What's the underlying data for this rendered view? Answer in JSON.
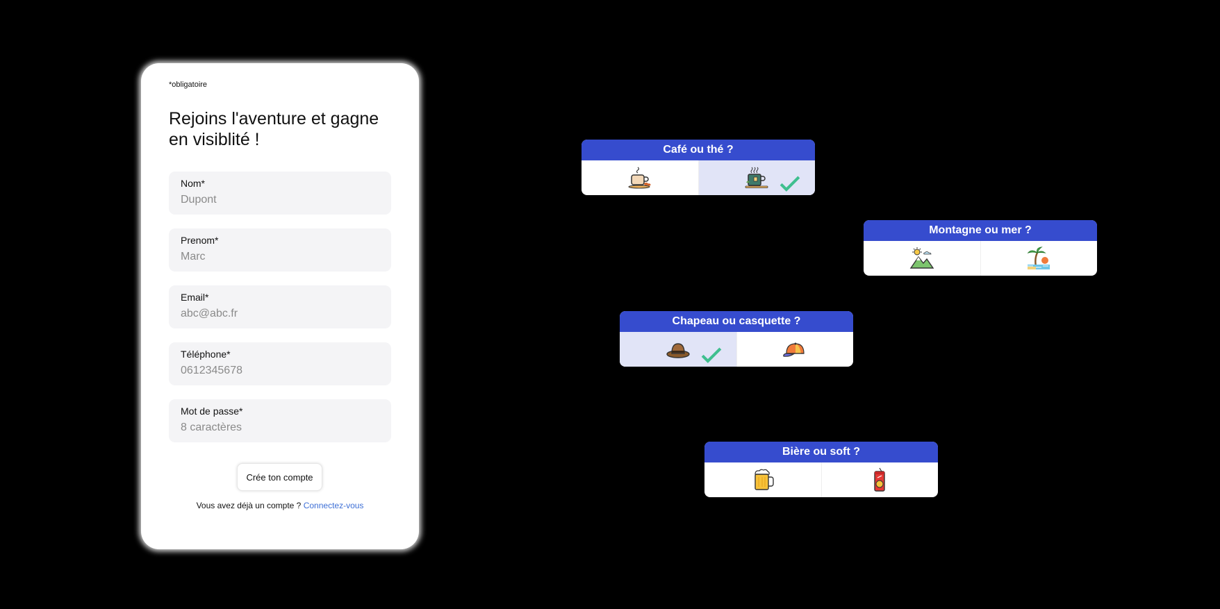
{
  "form": {
    "required_note": "*obligatoire",
    "title": "Rejoins l'aventure et gagne en visiblité !",
    "fields": [
      {
        "label": "Nom*",
        "placeholder": "Dupont"
      },
      {
        "label": "Prenom*",
        "placeholder": "Marc"
      },
      {
        "label": "Email*",
        "placeholder": "abc@abc.fr"
      },
      {
        "label": "Téléphone*",
        "placeholder": "0612345678"
      },
      {
        "label": "Mot de passe*",
        "placeholder": "8 caractères"
      }
    ],
    "submit_label": "Crée ton compte",
    "login_prompt": "Vous avez déjà un compte ?",
    "login_link": "Connectez-vous"
  },
  "choices": [
    {
      "question": "Café ou thé ?",
      "options": [
        {
          "icon": "coffee-cup-icon",
          "selected": false
        },
        {
          "icon": "tea-pot-icon",
          "selected": true
        }
      ]
    },
    {
      "question": "Montagne ou mer ?",
      "options": [
        {
          "icon": "mountain-icon",
          "selected": false
        },
        {
          "icon": "beach-palm-icon",
          "selected": false
        }
      ]
    },
    {
      "question": "Chapeau ou casquette ?",
      "options": [
        {
          "icon": "hat-icon",
          "selected": true
        },
        {
          "icon": "cap-icon",
          "selected": false
        }
      ]
    },
    {
      "question": "Bière ou soft ?",
      "options": [
        {
          "icon": "beer-mug-icon",
          "selected": false
        },
        {
          "icon": "soda-can-icon",
          "selected": false
        }
      ]
    }
  ],
  "colors": {
    "accent": "#364cce",
    "selected_bg": "#e1e4f7",
    "checkmark": "#3fbf8f",
    "link": "#3d6fd6"
  }
}
